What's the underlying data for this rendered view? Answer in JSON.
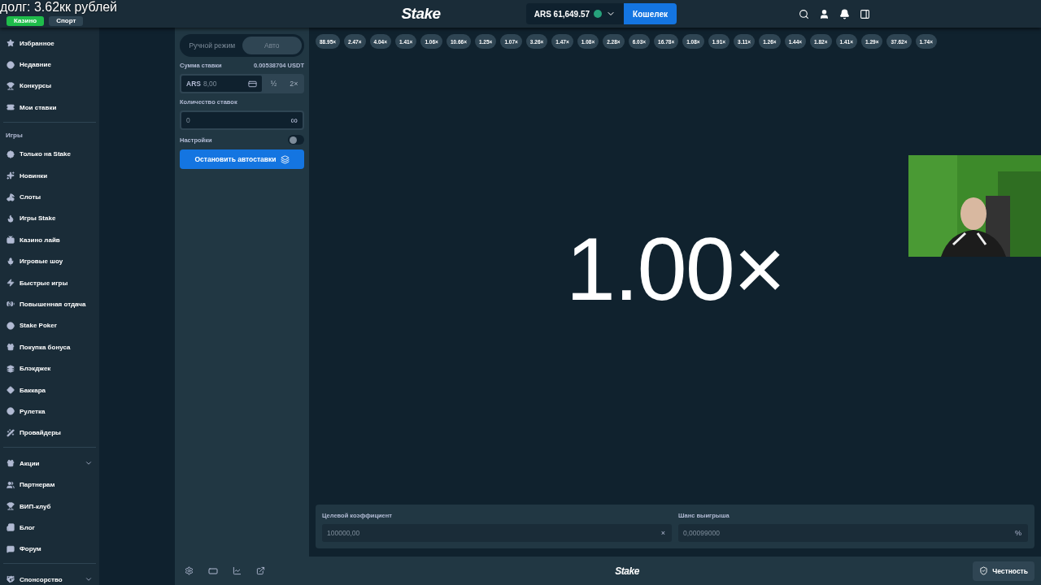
{
  "overlay_caption": "долг: 3.62кк рублей",
  "header": {
    "tabs": [
      {
        "label": "Казино",
        "selected": true
      },
      {
        "label": "Спорт",
        "selected": false
      }
    ],
    "logo": "Stake",
    "balance": "ARS 61,649.57",
    "wallet_button": "Кошелек"
  },
  "sidebar": {
    "sections": [
      {
        "items": [
          {
            "label": "Избранное",
            "has_submenu": false
          },
          {
            "label": "Недавние",
            "has_submenu": false
          },
          {
            "label": "Конкурсы",
            "has_submenu": false
          },
          {
            "label": "Мои ставки",
            "has_submenu": false
          }
        ]
      },
      {
        "heading": "Игры",
        "items": [
          {
            "label": "Только на Stake",
            "has_submenu": false
          },
          {
            "label": "Новинки",
            "has_submenu": false
          },
          {
            "label": "Слоты",
            "has_submenu": false
          },
          {
            "label": "Игры Stake",
            "has_submenu": false
          },
          {
            "label": "Казино лайв",
            "has_submenu": false
          },
          {
            "label": "Игровые шоу",
            "has_submenu": false
          },
          {
            "label": "Быстрые игры",
            "has_submenu": false
          },
          {
            "label": "Повышенная отдача",
            "has_submenu": false
          },
          {
            "label": "Stake Poker",
            "has_submenu": false
          },
          {
            "label": "Покупка бонуса",
            "has_submenu": false
          },
          {
            "label": "Блэкджек",
            "has_submenu": false
          },
          {
            "label": "Баккара",
            "has_submenu": false
          },
          {
            "label": "Рулетка",
            "has_submenu": false
          },
          {
            "label": "Провайдеры",
            "has_submenu": false
          }
        ]
      },
      {
        "items": [
          {
            "label": "Акции",
            "has_submenu": true
          },
          {
            "label": "Партнерам",
            "has_submenu": false
          },
          {
            "label": "ВИП-клуб",
            "has_submenu": false
          },
          {
            "label": "Блог",
            "has_submenu": false
          },
          {
            "label": "Форум",
            "has_submenu": false
          }
        ]
      },
      {
        "items": [
          {
            "label": "Спонсорство",
            "has_submenu": true
          }
        ]
      }
    ]
  },
  "bet_panel": {
    "modes": [
      {
        "label": "Ручной режим",
        "selected": false
      },
      {
        "label": "Авто",
        "selected": true
      }
    ],
    "bet_amount_label": "Сумма ставки",
    "bet_amount_usdt": "0.00538704 USDT",
    "currency": "ARS",
    "amount": "8,00",
    "half_button": "½",
    "double_button": "2×",
    "bets_count_label": "Количество ставок",
    "bets_count": "0",
    "infinity": "∞",
    "settings_label": "Настройки",
    "settings_on": false,
    "stop_button": "Остановить автоставки"
  },
  "recent_multipliers": [
    "88.95×",
    "2.47×",
    "4.04×",
    "1.41×",
    "1.06×",
    "10.66×",
    "1.25×",
    "1.07×",
    "3.26×",
    "1.47×",
    "1.08×",
    "2.28×",
    "6.03×",
    "16.78×",
    "1.08×",
    "1.91×",
    "3.11×",
    "1.26×",
    "1.44×",
    "1.82×",
    "1.41×",
    "1.29×",
    "37.62×",
    "1.74×"
  ],
  "multiplier": "1.00×",
  "target": {
    "label": "Целевой коэффициент",
    "value": "100000,00",
    "suffix": "×"
  },
  "chance": {
    "label": "Шанс выигрыша",
    "value": "0,00099000",
    "suffix": "%"
  },
  "footer": {
    "logo": "Stake",
    "fairness_button": "Честность"
  }
}
